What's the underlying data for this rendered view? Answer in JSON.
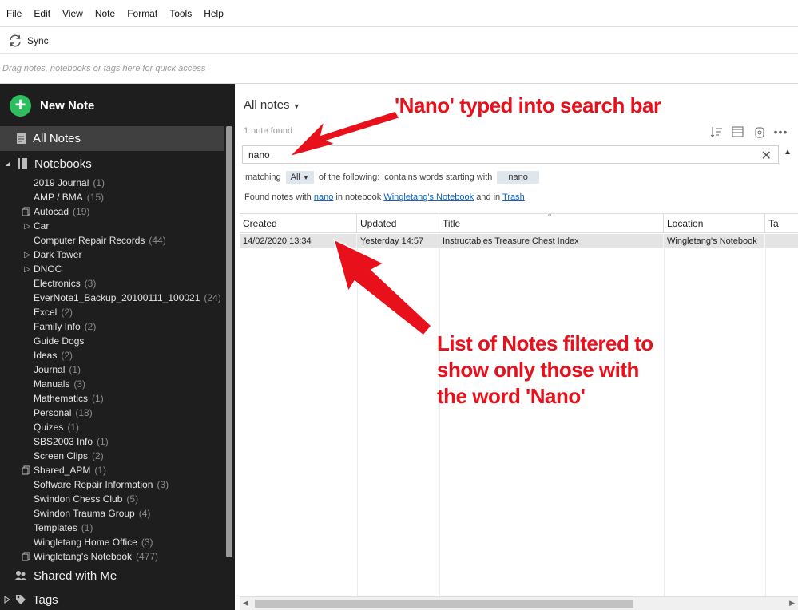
{
  "menu": [
    "File",
    "Edit",
    "View",
    "Note",
    "Format",
    "Tools",
    "Help"
  ],
  "sync_label": "Sync",
  "shortcuts_placeholder": "Drag notes, notebooks or tags here for quick access",
  "sidebar": {
    "new_note": "New Note",
    "all_notes": "All Notes",
    "notebooks": "Notebooks",
    "shared_with_me": "Shared with Me",
    "tags": "Tags",
    "items": [
      {
        "name": "2019 Journal",
        "count": "(1)",
        "prefix": ""
      },
      {
        "name": "AMP / BMA",
        "count": "(15)",
        "prefix": ""
      },
      {
        "name": "Autocad",
        "count": "(19)",
        "prefix": "stack"
      },
      {
        "name": "Car",
        "count": "",
        "prefix": "expand"
      },
      {
        "name": "Computer Repair Records",
        "count": "(44)",
        "prefix": ""
      },
      {
        "name": "Dark Tower",
        "count": "",
        "prefix": "expand"
      },
      {
        "name": "DNOC",
        "count": "",
        "prefix": "expand"
      },
      {
        "name": "Electronics",
        "count": "(3)",
        "prefix": ""
      },
      {
        "name": "EverNote1_Backup_20100111_100021",
        "count": "(24)",
        "prefix": ""
      },
      {
        "name": "Excel",
        "count": "(2)",
        "prefix": ""
      },
      {
        "name": "Family Info",
        "count": "(2)",
        "prefix": ""
      },
      {
        "name": "Guide Dogs",
        "count": "",
        "prefix": ""
      },
      {
        "name": "Ideas",
        "count": "(2)",
        "prefix": ""
      },
      {
        "name": "Journal",
        "count": "(1)",
        "prefix": ""
      },
      {
        "name": "Manuals",
        "count": "(3)",
        "prefix": ""
      },
      {
        "name": "Mathematics",
        "count": "(1)",
        "prefix": ""
      },
      {
        "name": "Personal",
        "count": "(18)",
        "prefix": ""
      },
      {
        "name": "Quizes",
        "count": "(1)",
        "prefix": ""
      },
      {
        "name": "SBS2003 Info",
        "count": "(1)",
        "prefix": ""
      },
      {
        "name": "Screen Clips",
        "count": "(2)",
        "prefix": ""
      },
      {
        "name": "Shared_APM",
        "count": "(1)",
        "prefix": "stack"
      },
      {
        "name": "Software Repair Information",
        "count": "(3)",
        "prefix": ""
      },
      {
        "name": "Swindon Chess Club",
        "count": "(5)",
        "prefix": ""
      },
      {
        "name": "Swindon Trauma Group",
        "count": "(4)",
        "prefix": ""
      },
      {
        "name": "Templates",
        "count": "(1)",
        "prefix": ""
      },
      {
        "name": "Wingletang Home Office",
        "count": "(3)",
        "prefix": ""
      },
      {
        "name": "Wingletang's Notebook",
        "count": "(477)",
        "prefix": "stack"
      }
    ]
  },
  "main": {
    "title": "All notes",
    "count_text": "1 note found",
    "search_value": "nano",
    "filter": {
      "matching": "matching",
      "all": "All",
      "of_following": "of the following:",
      "contains": "contains words starting with",
      "term": "nano"
    },
    "found": {
      "pre": "Found notes with",
      "term": "nano",
      "in_notebook": "in notebook",
      "notebook": "Wingletang's Notebook",
      "and_in": "and in",
      "trash": "Trash"
    },
    "columns": [
      "Created",
      "Updated",
      "Title",
      "Location",
      "Ta"
    ],
    "rows": [
      {
        "created": "14/02/2020 13:34",
        "updated": "Yesterday 14:57",
        "title": "Instructables Treasure Chest Index",
        "location": "Wingletang's Notebook"
      }
    ]
  },
  "annotations": {
    "search": "'Nano' typed into search bar",
    "list": [
      "List of Notes filtered to",
      "show only those with",
      "the word 'Nano'"
    ]
  },
  "colors": {
    "accent_green": "#2dbe60",
    "annotation_red": "#e8101a",
    "sidebar_bg": "#1e1e1e"
  }
}
